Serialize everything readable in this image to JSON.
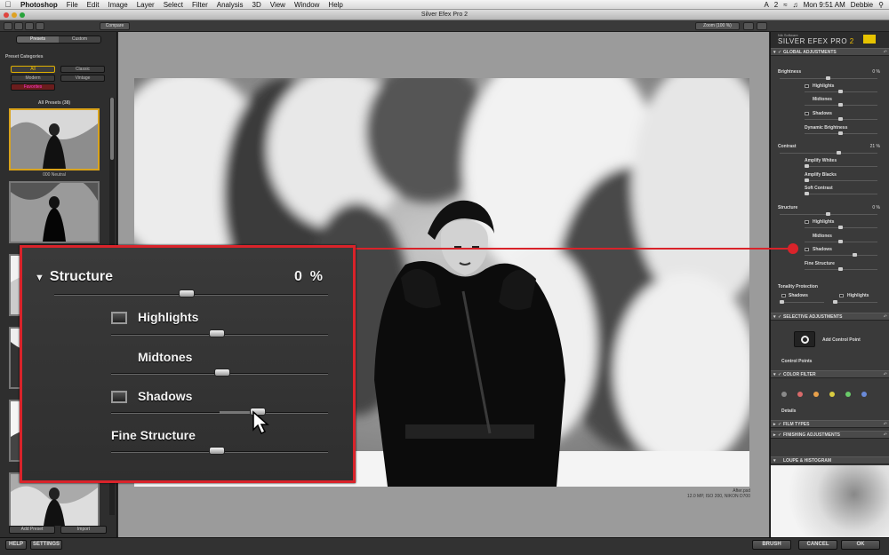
{
  "menubar": {
    "app": "Photoshop",
    "items": [
      "File",
      "Edit",
      "Image",
      "Layer",
      "Select",
      "Filter",
      "Analysis",
      "3D",
      "View",
      "Window",
      "Help"
    ],
    "status_icons": [
      "A",
      "2"
    ],
    "clock": "Mon 9:51 AM",
    "user": "Debbie"
  },
  "window": {
    "title": "Silver Efex Pro 2"
  },
  "toolbar": {
    "compare": "Compare",
    "zoom": "Zoom (100 %)"
  },
  "left_panel": {
    "tabs": [
      "Presets",
      "Custom"
    ],
    "active_tab": "Presets",
    "section": "Preset Categories",
    "categories": [
      "All",
      "Classic",
      "Modern",
      "Vintage",
      "Favorites"
    ],
    "active_category": "All",
    "all_presets": "All Presets (38)",
    "first_preset_label": "000 Neutral",
    "add_preset": "Add Preset",
    "import": "Import"
  },
  "image": {
    "filename": "After.psd",
    "info": "12.0 MP, ISO 200, NIKON D700"
  },
  "right_panel": {
    "brand_small": "Nik Software",
    "brand": "SILVER EFEX PRO",
    "brand_version": "2",
    "global": "GLOBAL ADJUSTMENTS",
    "brightness": {
      "label": "Brightness",
      "value": "0",
      "unit": "%"
    },
    "brightness_sub": [
      "Highlights",
      "Midtones",
      "Shadows",
      "Dynamic Brightness"
    ],
    "contrast": {
      "label": "Contrast",
      "value": "21",
      "unit": "%"
    },
    "contrast_sub": [
      "Amplify Whites",
      "Amplify Blacks",
      "Soft Contrast"
    ],
    "structure": {
      "label": "Structure",
      "value": "0",
      "unit": "%"
    },
    "structure_sub": [
      "Highlights",
      "Midtones",
      "Shadows",
      "Fine Structure"
    ],
    "tonality": "Tonality Protection",
    "tonality_sub": [
      "Shadows",
      "Highlights"
    ],
    "selective": "SELECTIVE ADJUSTMENTS",
    "add_control_point": "Add Control Point",
    "control_points": "Control Points",
    "color_filter": "COLOR FILTER",
    "filter_colors": [
      "#8a8a8a",
      "#d86a6a",
      "#e8a04a",
      "#d9cc40",
      "#6acb6a",
      "#6a8ad8"
    ],
    "details": "Details",
    "film_types": "FILM TYPES",
    "finishing": "FINISHING ADJUSTMENTS",
    "loupe": "LOUPE & HISTOGRAM"
  },
  "callout": {
    "title": "Structure",
    "value": "0",
    "unit": "%",
    "highlights": "Highlights",
    "midtones": "Midtones",
    "shadows": "Shadows",
    "fine_structure": "Fine Structure",
    "accent": "#d9232a"
  },
  "statusbar": {
    "help": "HELP",
    "settings": "SETTINGS",
    "brush": "BRUSH",
    "cancel": "CANCEL",
    "ok": "OK"
  }
}
